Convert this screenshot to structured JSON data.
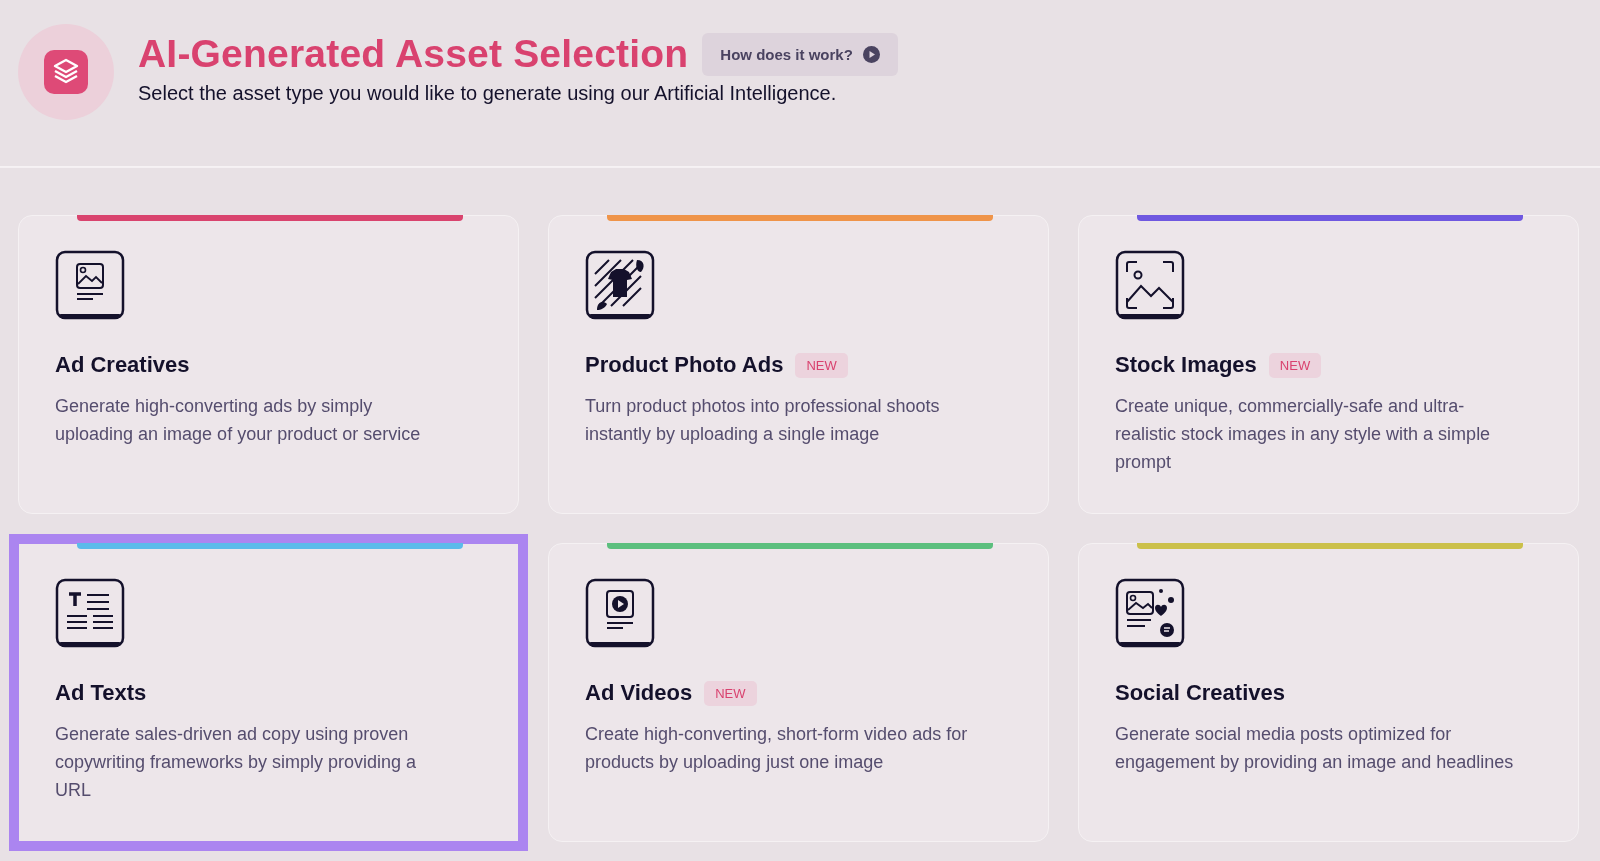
{
  "header": {
    "title": "AI-Generated Asset Selection",
    "help_button": "How does it work?",
    "subtitle": "Select the asset type you would like to generate using our Artificial Intelligence."
  },
  "cards": [
    {
      "kind": "image",
      "title": "Ad Creatives",
      "description": "Generate high-converting ads by simply uploading an image of your product or service",
      "color": "#d9436e",
      "selected": false
    },
    {
      "kind": "product",
      "title": "Product Photo Ads",
      "badge": "NEW",
      "description": "Turn product photos into professional shoots instantly by uploading a single image",
      "color": "#ef9449",
      "selected": false
    },
    {
      "kind": "landscape",
      "title": "Stock Images",
      "badge": "NEW",
      "description": "Create unique, commercially-safe and ultra-realistic stock images in any style with a simple prompt",
      "color": "#6f58e0",
      "selected": false
    },
    {
      "kind": "text",
      "title": "Ad Texts",
      "description": "Generate sales-driven ad copy using proven copywriting frameworks by simply providing a URL",
      "color": "#5bbbea",
      "selected": true
    },
    {
      "kind": "video",
      "title": "Ad Videos",
      "badge": "NEW",
      "description": "Create high-converting, short-form video ads for products by uploading just one image",
      "color": "#5cbf7e",
      "selected": false
    },
    {
      "kind": "social",
      "title": "Social Creatives",
      "description": "Generate social media posts optimized for engagement by providing an image and headlines",
      "color": "#cbc04a",
      "selected": false
    }
  ]
}
